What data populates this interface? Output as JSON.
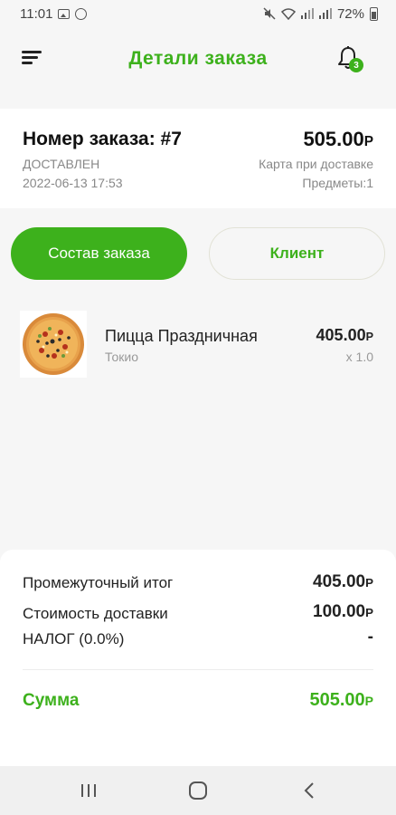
{
  "status_bar": {
    "time": "11:01",
    "battery": "72%"
  },
  "header": {
    "title": "Детали заказа",
    "notification_count": "3"
  },
  "order": {
    "number_label": "Номер заказа: #7",
    "status": "ДОСТАВЛЕН",
    "date": "2022-06-13 17:53",
    "total": "505.00",
    "currency": "Р",
    "payment_method": "Карта при доставке",
    "items_count": "Предметы:1"
  },
  "tabs": {
    "order_composition": "Состав заказа",
    "client": "Клиент"
  },
  "products": [
    {
      "name": "Пицца Праздничная",
      "store": "Токио",
      "price": "405.00",
      "quantity": "x 1.0"
    }
  ],
  "summary": {
    "subtotal_label": "Промежуточный итог",
    "subtotal_value": "405.00",
    "delivery_label": "Стоимость доставки",
    "delivery_value": "100.00",
    "tax_label": "НАЛОГ (0.0%)",
    "tax_value": "-",
    "total_label": "Сумма",
    "total_value": "505.00"
  },
  "colors": {
    "accent": "#3db11c",
    "background": "#f6f6f6",
    "card": "#ffffff"
  },
  "icons": {
    "menu": "menu-icon",
    "notifications": "bell-icon",
    "nav_recent": "recent-apps-icon",
    "nav_home": "home-icon",
    "nav_back": "back-icon"
  }
}
